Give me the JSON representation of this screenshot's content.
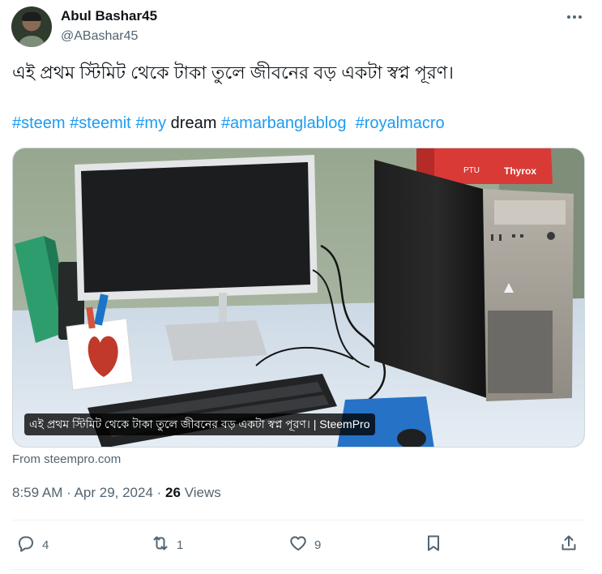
{
  "author": {
    "name": "Abul Bashar45",
    "handle": "@ABashar45"
  },
  "tweet": {
    "text": "এই প্রথম স্টিমিট থেকে টাকা তুলে জীবনের বড় একটা স্বপ্ন পূরণ।",
    "hashtags": [
      {
        "text": "#steem",
        "link": true
      },
      {
        "text": "#steemit",
        "link": true
      },
      {
        "text": "#my",
        "link": true
      },
      {
        "text": "dream",
        "link": false
      },
      {
        "text": "#amarbanglablog",
        "link": true
      },
      {
        "text": "#royalmacro",
        "link": true
      }
    ]
  },
  "media": {
    "caption": "এই প্রথম স্টিমিট থেকে টাকা তুলে জীবনের বড় একটা স্বপ্ন পূরণ। | SteemPro",
    "box_brand": "Thyrox",
    "box_label": "PTU"
  },
  "link_source": "From steempro.com",
  "meta": {
    "time": "8:59 AM",
    "date": "Apr 29, 2024",
    "views_count": "26",
    "views_label": "Views"
  },
  "actions": {
    "replies": "4",
    "reposts": "1",
    "likes": "9"
  },
  "icons": {
    "more": "more-icon",
    "reply": "reply-icon",
    "repost": "repost-icon",
    "like": "like-icon",
    "bookmark": "bookmark-icon",
    "share": "share-icon"
  },
  "colors": {
    "link": "#1d9bf0",
    "secondary_text": "#536471",
    "primary_text": "#0f1419",
    "border": "#cfd9de"
  }
}
